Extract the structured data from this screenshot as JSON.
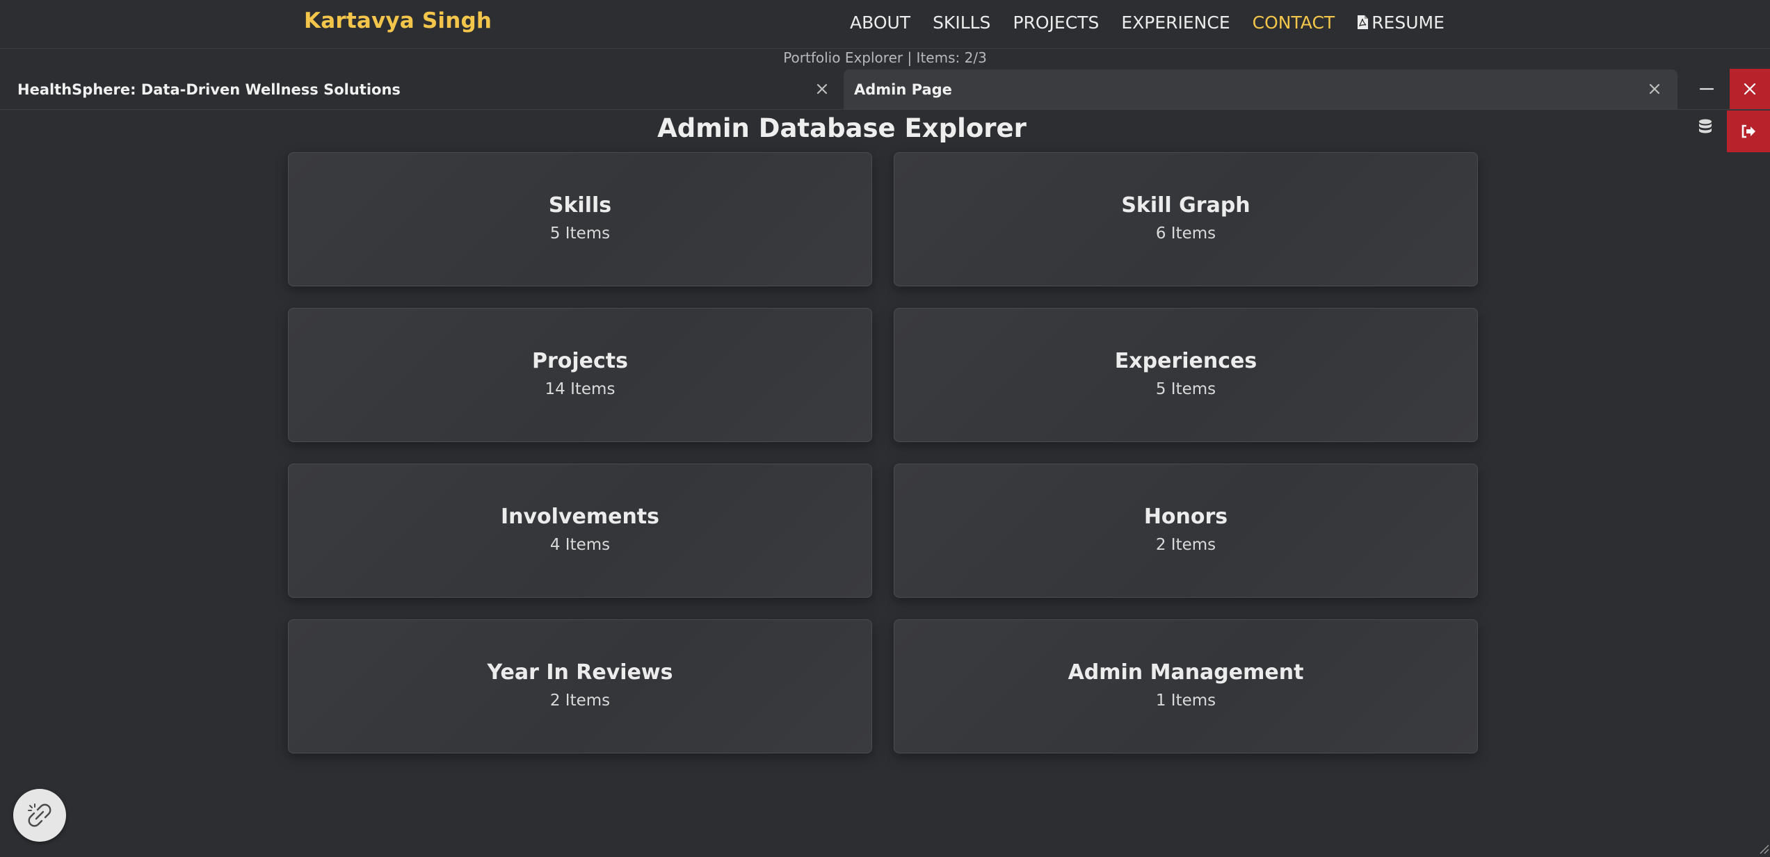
{
  "navbar": {
    "brand": "Kartavya Singh",
    "links": [
      {
        "label": "ABOUT",
        "active": false
      },
      {
        "label": "SKILLS",
        "active": false
      },
      {
        "label": "PROJECTS",
        "active": false
      },
      {
        "label": "EXPERIENCE",
        "active": false
      },
      {
        "label": "CONTACT",
        "active": true
      },
      {
        "label": "RESUME",
        "active": false,
        "icon": "pdf-file-icon"
      }
    ]
  },
  "status_line": "Portfolio Explorer | Items: 2/3",
  "tabs": [
    {
      "label": "HealthSphere: Data-Driven Wellness Solutions",
      "active": false
    },
    {
      "label": "Admin Page",
      "active": true
    }
  ],
  "window_controls": {
    "minimize_icon": "minus-icon",
    "close_icon": "close-icon"
  },
  "toolbar": {
    "database_icon": "database-icon",
    "logout_icon": "sign-out-icon"
  },
  "main": {
    "title": "Admin Database Explorer",
    "cards": [
      {
        "title": "Skills",
        "count": "5 Items"
      },
      {
        "title": "Skill Graph",
        "count": "6 Items"
      },
      {
        "title": "Projects",
        "count": "14 Items"
      },
      {
        "title": "Experiences",
        "count": "5 Items"
      },
      {
        "title": "Involvements",
        "count": "4 Items"
      },
      {
        "title": "Honors",
        "count": "2 Items"
      },
      {
        "title": "Year In Reviews",
        "count": "2 Items"
      },
      {
        "title": "Admin Management",
        "count": "1 Items"
      }
    ]
  },
  "floating_button": {
    "icon": "unlink-icon"
  },
  "colors": {
    "background": "#2c2e31",
    "brand": "#f3c64b",
    "active_link": "#f3c64b",
    "danger": "#b8232b",
    "card_border": "#4a4c50"
  }
}
